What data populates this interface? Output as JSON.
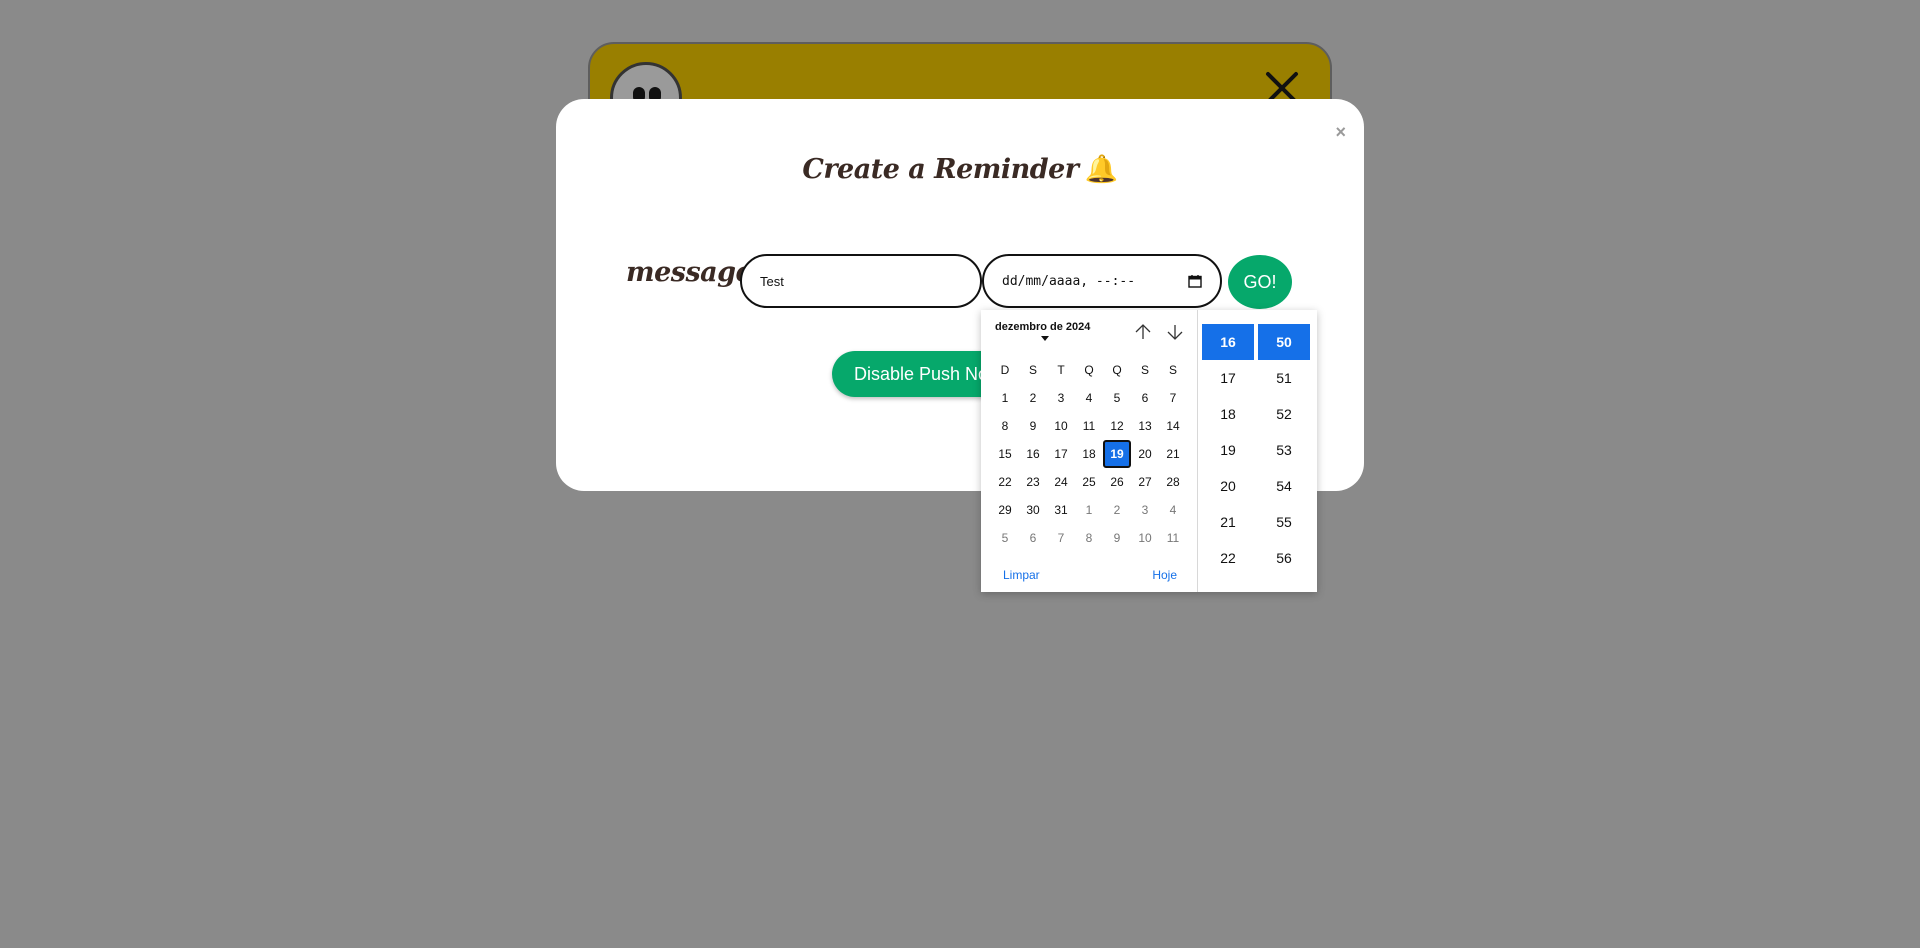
{
  "modal": {
    "title": "Create a Reminder",
    "title_icon": "🔔",
    "close_label": "×",
    "message_label": "message:",
    "message_value": "Test",
    "datetime_placeholder": "dd/mm/aaaa, --:--",
    "go_label": "GO!",
    "push_button_label": "Disable Push Notifications"
  },
  "picker": {
    "month_label": "dezembro de 2024",
    "weekdays": [
      "D",
      "S",
      "T",
      "Q",
      "Q",
      "S",
      "S"
    ],
    "weeks": [
      [
        {
          "d": "1"
        },
        {
          "d": "2"
        },
        {
          "d": "3"
        },
        {
          "d": "4"
        },
        {
          "d": "5"
        },
        {
          "d": "6"
        },
        {
          "d": "7"
        }
      ],
      [
        {
          "d": "8"
        },
        {
          "d": "9"
        },
        {
          "d": "10"
        },
        {
          "d": "11"
        },
        {
          "d": "12"
        },
        {
          "d": "13"
        },
        {
          "d": "14"
        }
      ],
      [
        {
          "d": "15"
        },
        {
          "d": "16"
        },
        {
          "d": "17"
        },
        {
          "d": "18"
        },
        {
          "d": "19",
          "selected": true
        },
        {
          "d": "20"
        },
        {
          "d": "21"
        }
      ],
      [
        {
          "d": "22"
        },
        {
          "d": "23"
        },
        {
          "d": "24"
        },
        {
          "d": "25"
        },
        {
          "d": "26"
        },
        {
          "d": "27"
        },
        {
          "d": "28"
        }
      ],
      [
        {
          "d": "29"
        },
        {
          "d": "30"
        },
        {
          "d": "31"
        },
        {
          "d": "1",
          "other": true
        },
        {
          "d": "2",
          "other": true
        },
        {
          "d": "3",
          "other": true
        },
        {
          "d": "4",
          "other": true
        }
      ],
      [
        {
          "d": "5",
          "other": true
        },
        {
          "d": "6",
          "other": true
        },
        {
          "d": "7",
          "other": true
        },
        {
          "d": "8",
          "other": true
        },
        {
          "d": "9",
          "other": true
        },
        {
          "d": "10",
          "other": true
        },
        {
          "d": "11",
          "other": true
        }
      ]
    ],
    "clear_label": "Limpar",
    "today_label": "Hoje",
    "hours": [
      "16",
      "17",
      "18",
      "19",
      "20",
      "21",
      "22"
    ],
    "selected_hour": "16",
    "minutes": [
      "50",
      "51",
      "52",
      "53",
      "54",
      "55",
      "56"
    ],
    "selected_minute": "50"
  },
  "colors": {
    "overlay": "#8a8a8a",
    "background_card": "#997f00",
    "accent_green": "#06a86b",
    "selection_blue": "#1570e8",
    "title_text": "#3a2a24"
  }
}
